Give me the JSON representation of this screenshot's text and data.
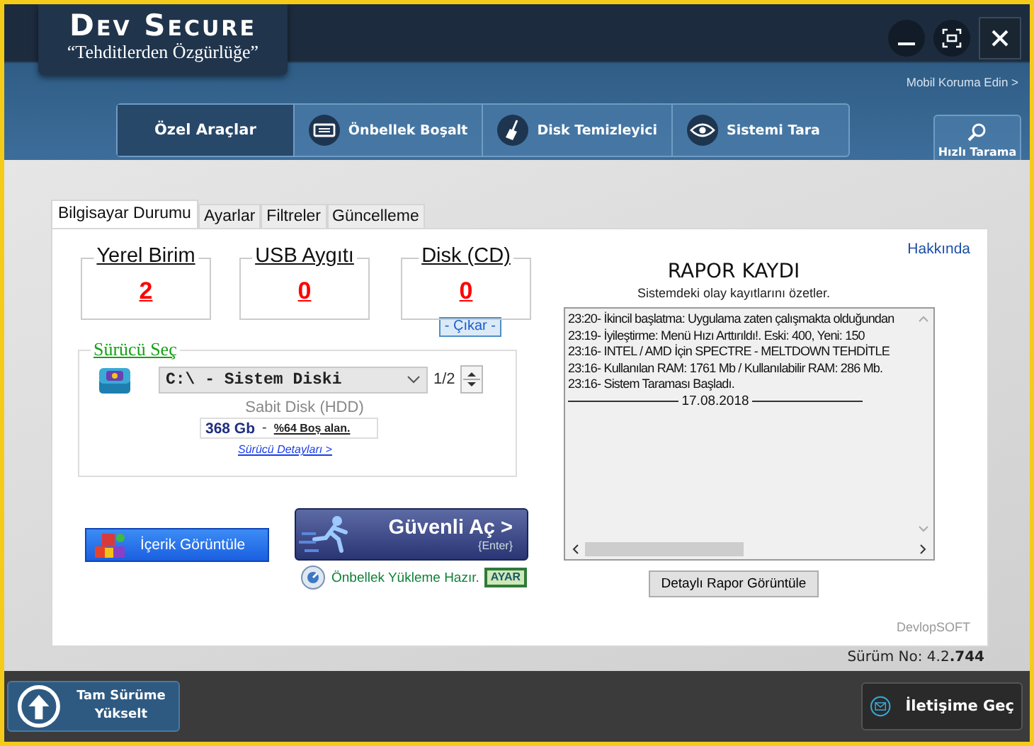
{
  "app": {
    "title": "Dev Secure",
    "slogan": "“Tehditlerden Özgürlüğe”"
  },
  "mobile_link": "Mobil Koruma Edin >",
  "nav": [
    {
      "label": "Özel Araçlar",
      "kind": "plain",
      "selected": true
    },
    {
      "label": "Önbellek Boşalt",
      "kind": "memory",
      "selected": false
    },
    {
      "label": "Disk Temizleyici",
      "kind": "broom",
      "selected": false
    },
    {
      "label": "Sistemi Tara",
      "kind": "eye",
      "selected": false
    }
  ],
  "quick_scan": "Hızlı Tarama",
  "tabs": [
    {
      "label": "Bilgisayar Durumu",
      "selected": true
    },
    {
      "label": "Ayarlar",
      "selected": false
    },
    {
      "label": "Filtreler",
      "selected": false
    },
    {
      "label": "Güncelleme",
      "selected": false
    }
  ],
  "counters": [
    {
      "label": "Yerel Birim",
      "value": "2"
    },
    {
      "label": "USB Aygıtı",
      "value": "0"
    },
    {
      "label": "Disk (CD)",
      "value": "0"
    }
  ],
  "eject_button": "- Çıkar -",
  "drive": {
    "title": "Sürücü Seç",
    "value": "C:\\ - Sistem Diski",
    "counter": "1/2",
    "type": "Sabit Disk (HDD)",
    "size": "368 Gb",
    "separator": "-",
    "free": "%64 Boş alan.",
    "details_link": "Sürücü Detayları >"
  },
  "about_link": "Hakkında",
  "report": {
    "title": "RAPOR KAYDI",
    "subtitle": "Sistemdeki olay kayıtlarını özetler.",
    "lines": [
      "23:20- İkincil başlatma: Uygulama zaten çalışmakta olduğundan",
      "23:19- İyileştirme: Menü Hızı Arttırıldı!. Eski: 400, Yeni: 150",
      "23:16- INTEL / AMD  İçin SPECTRE - MELTDOWN TEHDİTLE",
      "23:16- Kullanılan RAM: 1761 Mb  /  Kullanılabilir RAM: 286 Mb.",
      "23:16- Sistem Taraması Başladı."
    ],
    "date": "17.08.2018",
    "button": "Detaylı Rapor Görüntüle"
  },
  "content_button": "İçerik Görüntüle",
  "open_button": {
    "label": "Güvenli Aç >",
    "hint": "{Enter}"
  },
  "cache_status": "Önbellek Yükleme Hazır.",
  "settings_button": "AYAR",
  "brand": "DevlopSOFT",
  "version": "Sürüm No: 4.2**.744**",
  "upgrade_button": "Tam Sürüme Yükselt",
  "contact_button": "İletişime Geç"
}
